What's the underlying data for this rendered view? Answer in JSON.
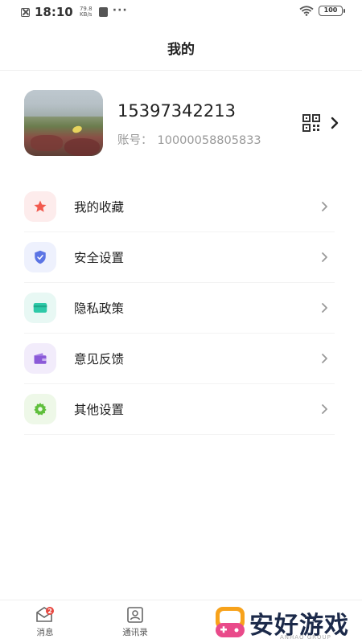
{
  "status_bar": {
    "time": "18:10",
    "speed_value": "79.8",
    "speed_unit": "KB/s",
    "more": "···",
    "battery": "100"
  },
  "header": {
    "title": "我的"
  },
  "profile": {
    "phone": "15397342213",
    "account_label": "账号：",
    "account_value": "10000058805833"
  },
  "menu": [
    {
      "label": "我的收藏",
      "icon": "star-icon",
      "color": "#f25a4e",
      "bg": "#fdecec"
    },
    {
      "label": "安全设置",
      "icon": "shield-icon",
      "color": "#5b74e4",
      "bg": "#eef1fd"
    },
    {
      "label": "隐私政策",
      "icon": "card-icon",
      "color": "#2ec9a8",
      "bg": "#e8f8f4"
    },
    {
      "label": "意见反馈",
      "icon": "wallet-icon",
      "color": "#8b5ad8",
      "bg": "#f2ecfb"
    },
    {
      "label": "其他设置",
      "icon": "gear-icon",
      "color": "#5fbf3c",
      "bg": "#eef8e8"
    }
  ],
  "bottom_nav": {
    "messages_label": "消息",
    "messages_badge": "2",
    "contacts_label": "通讯录"
  },
  "watermark": {
    "text": "安好游戏",
    "sub": "ANHAO GROUP"
  }
}
